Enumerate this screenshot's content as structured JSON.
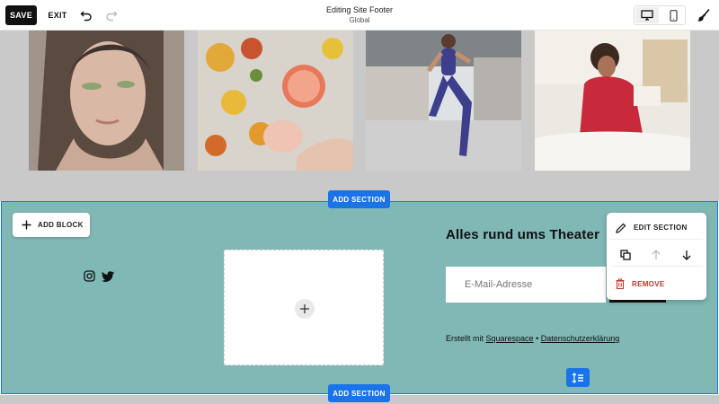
{
  "toolbar": {
    "save_label": "SAVE",
    "exit_label": "EXIT",
    "title": "Editing Site Footer",
    "subtitle": "Global",
    "icons": [
      "undo-icon",
      "redo-icon",
      "desktop-icon",
      "mobile-icon",
      "paintbrush-icon"
    ]
  },
  "gallery": {
    "images": [
      "portrait-woman-photo",
      "citrus-fruits-photo",
      "runner-woman-photo",
      "reading-woman-photo"
    ]
  },
  "section": {
    "add_section_label": "ADD SECTION",
    "add_block_label": "ADD BLOCK",
    "newsletter_title": "Alles rund ums Theater",
    "email_placeholder": "E-Mail-Adresse",
    "credits_prefix": "Erstellt mit ",
    "credits_link1": "Squarespace",
    "credits_separator": " • ",
    "credits_link2": "Datenschutzerklärung"
  },
  "context_menu": {
    "edit_label": "EDIT SECTION",
    "remove_label": "REMOVE"
  },
  "colors": {
    "accent": "#1a73e8",
    "section_bg": "#7fb8b4",
    "remove": "#c0392b"
  }
}
